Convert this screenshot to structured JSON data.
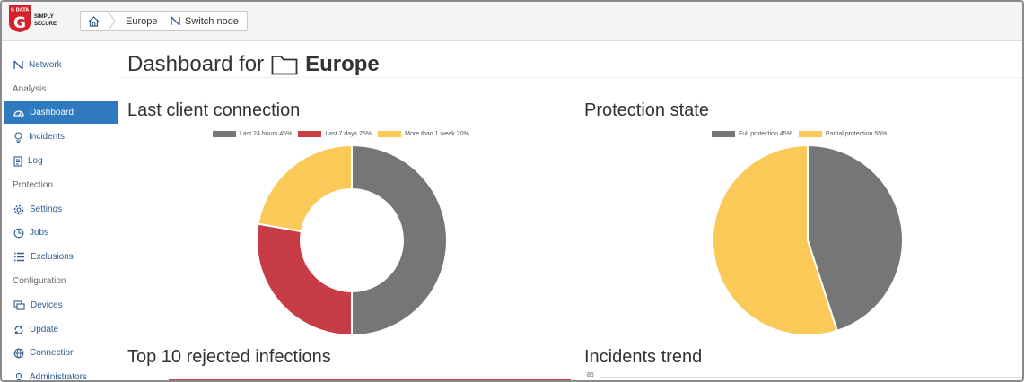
{
  "header": {
    "logo_brand": "G DATA",
    "logo_tagline_1": "SIMPLY",
    "logo_tagline_2": "SECURE",
    "breadcrumb_current": "Europe",
    "switch_node_label": "Switch node"
  },
  "sidebar": {
    "items": [
      {
        "label": "Network",
        "icon": "network-icon"
      },
      {
        "heading": "Analysis"
      },
      {
        "label": "Dashboard",
        "icon": "dashboard-icon",
        "active": true
      },
      {
        "label": "Incidents",
        "icon": "incidents-icon"
      },
      {
        "label": "Log",
        "icon": "log-icon"
      },
      {
        "heading": "Protection"
      },
      {
        "label": "Settings",
        "icon": "gear-icon"
      },
      {
        "label": "Jobs",
        "icon": "jobs-icon"
      },
      {
        "label": "Exclusions",
        "icon": "list-icon"
      },
      {
        "heading": "Configuration"
      },
      {
        "label": "Devices",
        "icon": "devices-icon"
      },
      {
        "label": "Update",
        "icon": "update-icon"
      },
      {
        "label": "Connection",
        "icon": "globe-icon"
      },
      {
        "label": "Administrators",
        "icon": "user-icon"
      }
    ]
  },
  "main": {
    "title_prefix": "Dashboard for",
    "title_node": "Europe",
    "sections": {
      "last_client_connection": "Last client connection",
      "protection_state": "Protection state",
      "top10_rejected": "Top 10 rejected infections",
      "incidents_trend": "Incidents trend"
    },
    "incidents_trend_y_top": "85"
  },
  "colors": {
    "accent": "#2f7abf",
    "gray": "#767676",
    "red": "#c83c46",
    "yellow": "#fbc957"
  },
  "chart_data": [
    {
      "type": "pie",
      "variant": "doughnut",
      "title": "Last client connection",
      "series": [
        {
          "name": "Last 24 hours 45%",
          "value": 45,
          "color": "#767676"
        },
        {
          "name": "Last 7 days 25%",
          "value": 25,
          "color": "#c83c46"
        },
        {
          "name": "More than 1 week 20%",
          "value": 20,
          "color": "#fbc957"
        }
      ],
      "legend": "top"
    },
    {
      "type": "pie",
      "title": "Protection state",
      "series": [
        {
          "name": "Full protection 45%",
          "value": 45,
          "color": "#767676"
        },
        {
          "name": "Partial protection 55%",
          "value": 55,
          "color": "#fbc957"
        }
      ],
      "legend": "top"
    }
  ]
}
